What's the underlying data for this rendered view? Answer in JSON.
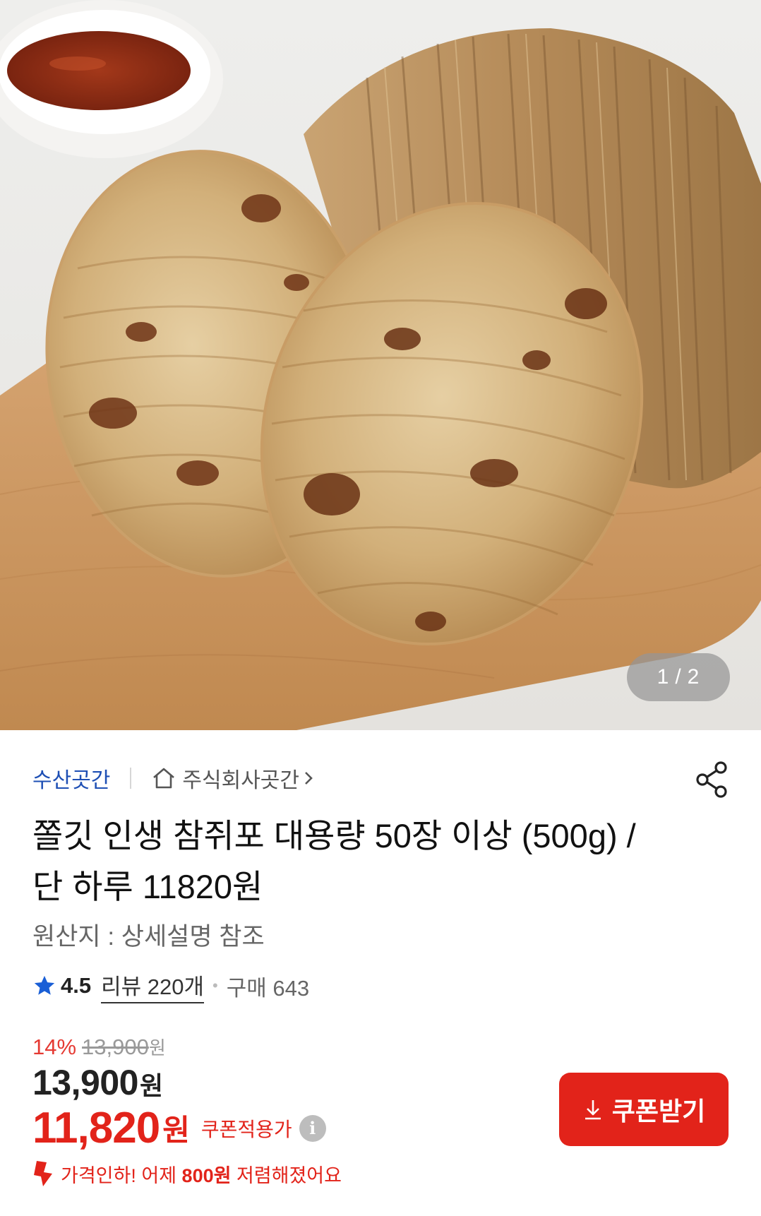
{
  "gallery": {
    "current": "1",
    "separator": "/",
    "total": "2",
    "image_description_icon": "grilled-pollock-jerky-on-wooden-board"
  },
  "seller": {
    "brand": "수산곳간",
    "store": "주식회사곳간",
    "home_icon": "home-icon",
    "share_icon": "share-icon"
  },
  "product": {
    "title": "쫄깃 인생 참쥐포 대용량 50장 이상 (500g) / 단 하루 11820원",
    "origin": "원산지 : 상세설명 참조"
  },
  "rating": {
    "score": "4.5",
    "reviews": "리뷰 220개",
    "separator": "•",
    "purchases": "구매 643"
  },
  "pricing": {
    "discount_rate": "14%",
    "original_price": "13,900",
    "original_unit": "원",
    "price": "13,900",
    "price_unit": "원",
    "coupon_price": "11,820",
    "coupon_unit": "원",
    "coupon_label": "쿠폰적용가",
    "info_icon": "i"
  },
  "coupon_button": {
    "label": "쿠폰받기"
  },
  "price_drop": {
    "prefix": "가격인하! 어제 ",
    "amount": "800원",
    "suffix": " 저렴해졌어요"
  },
  "colors": {
    "accent_red": "#e2231a",
    "brand_blue": "#1e4fb4",
    "rating_star": "#1a5fd6"
  }
}
